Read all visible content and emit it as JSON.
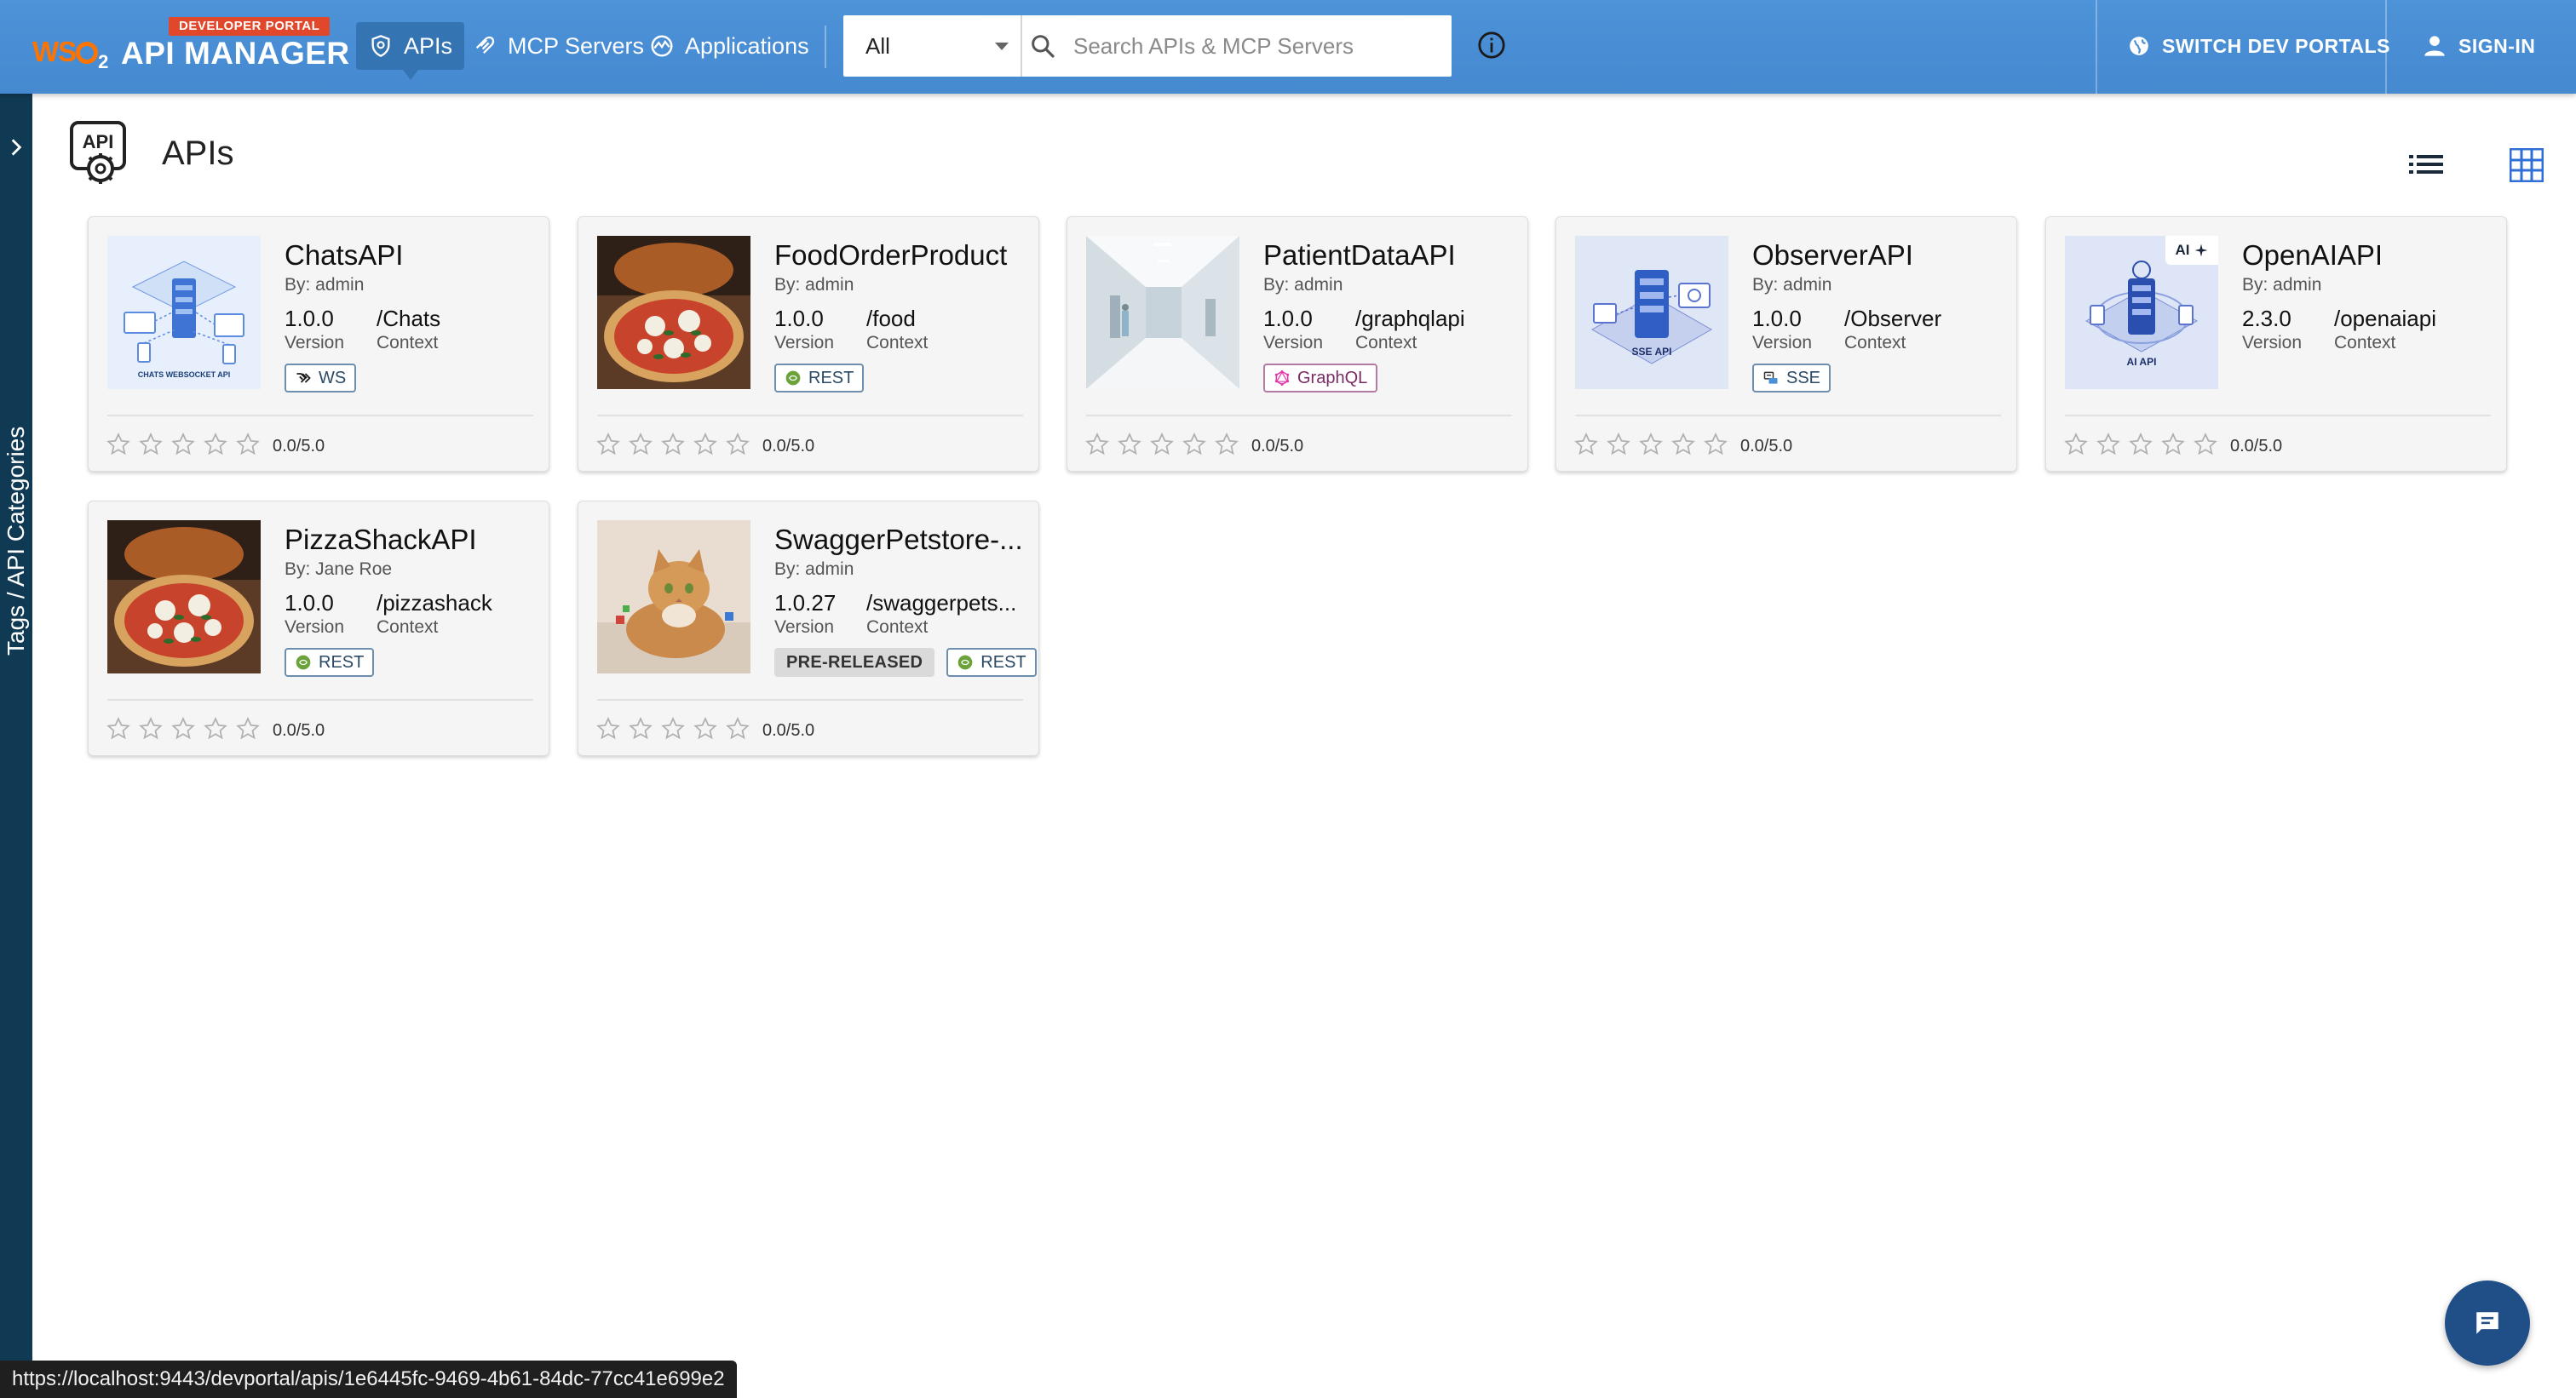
{
  "brand": {
    "badge": "DEVELOPER PORTAL",
    "logo_text": "WSO2",
    "product": "API MANAGER"
  },
  "nav": {
    "items": [
      {
        "label": "APIs",
        "icon": "api-shield-icon",
        "active": true
      },
      {
        "label": "MCP Servers",
        "icon": "mcp-icon",
        "active": false
      },
      {
        "label": "Applications",
        "icon": "applications-icon",
        "active": false
      }
    ]
  },
  "search": {
    "scope_value": "All",
    "placeholder": "Search APIs & MCP Servers"
  },
  "header_right": {
    "switch_label": "SWITCH DEV PORTALS",
    "signin_label": "SIGN-IN"
  },
  "side_panel": {
    "label": "Tags / API Categories"
  },
  "page": {
    "title": "APIs"
  },
  "cards": [
    {
      "name": "ChatsAPI",
      "by": "By: admin",
      "version": "1.0.0",
      "version_label": "Version",
      "context": "/Chats",
      "context_label": "Context",
      "chips": [
        {
          "label": "WS",
          "type": "ws"
        }
      ],
      "rating": "0.0/5.0",
      "thumb_caption": "CHATS WEBSOCKET API"
    },
    {
      "name": "FoodOrderProduct",
      "by": "By: admin",
      "version": "1.0.0",
      "version_label": "Version",
      "context": "/food",
      "context_label": "Context",
      "chips": [
        {
          "label": "REST",
          "type": "rest"
        }
      ],
      "rating": "0.0/5.0"
    },
    {
      "name": "PatientDataAPI",
      "by": "By: admin",
      "version": "1.0.0",
      "version_label": "Version",
      "context": "/graphqlapi",
      "context_label": "Context",
      "chips": [
        {
          "label": "GraphQL",
          "type": "graphql"
        }
      ],
      "rating": "0.0/5.0"
    },
    {
      "name": "ObserverAPI",
      "by": "By: admin",
      "version": "1.0.0",
      "version_label": "Version",
      "context": "/Observer",
      "context_label": "Context",
      "chips": [
        {
          "label": "SSE",
          "type": "sse"
        }
      ],
      "rating": "0.0/5.0",
      "thumb_caption": "SSE API"
    },
    {
      "name": "OpenAIAPI",
      "by": "By: admin",
      "version": "2.3.0",
      "version_label": "Version",
      "context": "/openaiapi",
      "context_label": "Context",
      "chips": [],
      "rating": "0.0/5.0",
      "thumb_caption": "AI API",
      "ai_badge": "AI"
    },
    {
      "name": "PizzaShackAPI",
      "by": "By: Jane Roe",
      "version": "1.0.0",
      "version_label": "Version",
      "context": "/pizzashack",
      "context_label": "Context",
      "chips": [
        {
          "label": "REST",
          "type": "rest"
        }
      ],
      "rating": "0.0/5.0"
    },
    {
      "name": "SwaggerPetstore-...",
      "by": "By: admin",
      "version": "1.0.27",
      "version_label": "Version",
      "context": "/swaggerpets...",
      "context_label": "Context",
      "chips": [
        {
          "label": "PRE-RELEASED",
          "type": "pre"
        },
        {
          "label": "REST",
          "type": "rest"
        }
      ],
      "rating": "0.0/5.0"
    }
  ],
  "status_url": "https://localhost:9443/devportal/apis/1e6445fc-9469-4b61-84dc-77cc41e699e2",
  "colors": {
    "topbar": "#4a90d6",
    "side_strip": "#103a54",
    "brand_orange": "#ff7300",
    "chat_fab": "#1f4f86"
  }
}
